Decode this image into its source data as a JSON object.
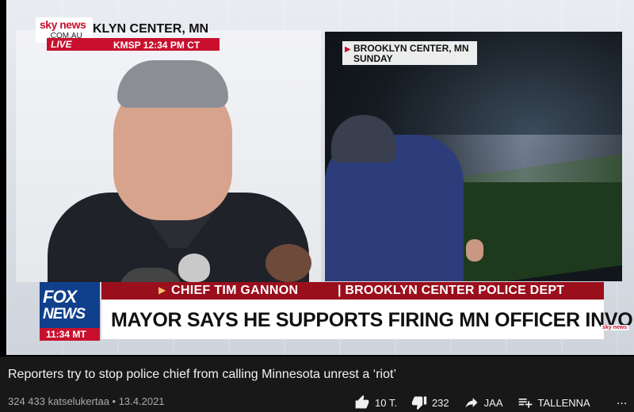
{
  "video": {
    "sky_brand": "sky news",
    "sky_sub": ".COM.AU",
    "location_top": "KLYN CENTER, MN",
    "live_label": "LIVE",
    "live_time": "KMSP   12:34 PM CT",
    "right_location_line1": "BROOKLYN CENTER, MN",
    "right_location_line2": "SUNDAY",
    "fox_line1": "FOX",
    "fox_line2": "NEWS",
    "fox_time": "11:34 MT",
    "lower_third_name": "CHIEF TIM GANNON",
    "lower_third_dept": "| BROOKLYN CENTER POLICE DEPT",
    "headline": "MAYOR SAYS HE SUPPORTS FIRING MN OFFICER INVOLVED",
    "sky_mini": "sky news"
  },
  "info": {
    "title": "Reporters try to stop police chief from calling Minnesota unrest a ‘riot’",
    "meta": "324 433 katselukertaa • 13.4.2021"
  },
  "actions": {
    "like_count": "10 T.",
    "dislike_count": "232",
    "share_label": "JAA",
    "save_label": "TALLENNA",
    "more_label": "..."
  },
  "colors": {
    "background": "#181818",
    "fox_blue": "#103f8c",
    "fox_red": "#9b0e1c",
    "sky_red": "#c8102e"
  },
  "icons": [
    "thumbs-up-icon",
    "thumbs-down-icon",
    "share-icon",
    "playlist-add-icon",
    "more-icon"
  ]
}
